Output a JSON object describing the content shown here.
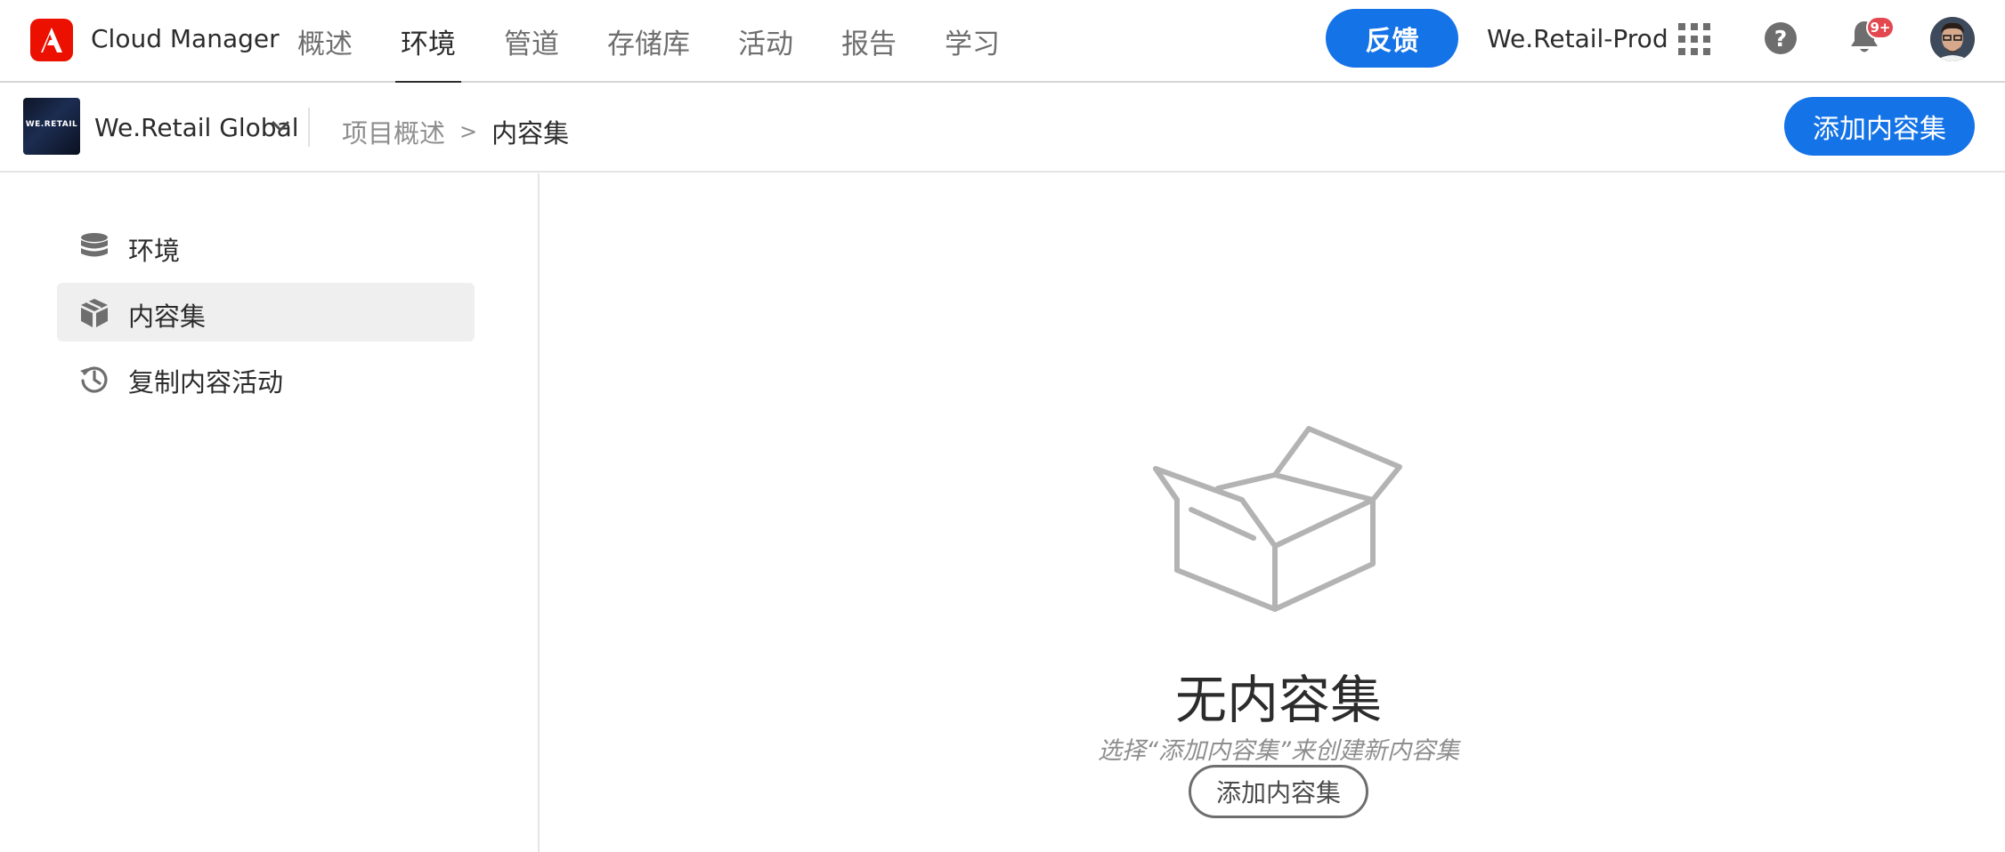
{
  "topbar": {
    "logo_icon": "adobe-logo-icon",
    "brand_color": "#eb1000",
    "app_title": "Cloud Manager",
    "tabs": [
      {
        "label": "概述",
        "active": false
      },
      {
        "label": "环境",
        "active": true
      },
      {
        "label": "管道",
        "active": false
      },
      {
        "label": "存储库",
        "active": false
      },
      {
        "label": "活动",
        "active": false
      },
      {
        "label": "报告",
        "active": false
      },
      {
        "label": "学习",
        "active": false
      }
    ],
    "feedback_label": "反馈",
    "org_name": "We.Retail-Prod",
    "apps_icon": "apps-grid-icon",
    "help_icon": "help-icon",
    "help_glyph": "?",
    "notifications_icon": "bell-icon",
    "notifications_badge": "9+",
    "badge_color": "#e34850",
    "avatar_icon": "user-avatar"
  },
  "subheader": {
    "program_thumb_text": "WE.RETAIL",
    "program_name": "We.Retail Global",
    "breadcrumb": [
      {
        "label": "项目概述",
        "current": false
      },
      {
        "label": "内容集",
        "current": true
      }
    ],
    "breadcrumb_separator": ">",
    "add_button_label": "添加内容集",
    "accent_color": "#1473e6"
  },
  "sidebar": {
    "items": [
      {
        "label": "环境",
        "icon": "database-icon",
        "selected": false
      },
      {
        "label": "内容集",
        "icon": "box-icon",
        "selected": true
      },
      {
        "label": "复制内容活动",
        "icon": "history-icon",
        "selected": false
      }
    ]
  },
  "empty_state": {
    "illustration": "open-box-illustration",
    "title": "无内容集",
    "description": "选择“添加内容集”来创建新内容集",
    "button_label": "添加内容集"
  }
}
